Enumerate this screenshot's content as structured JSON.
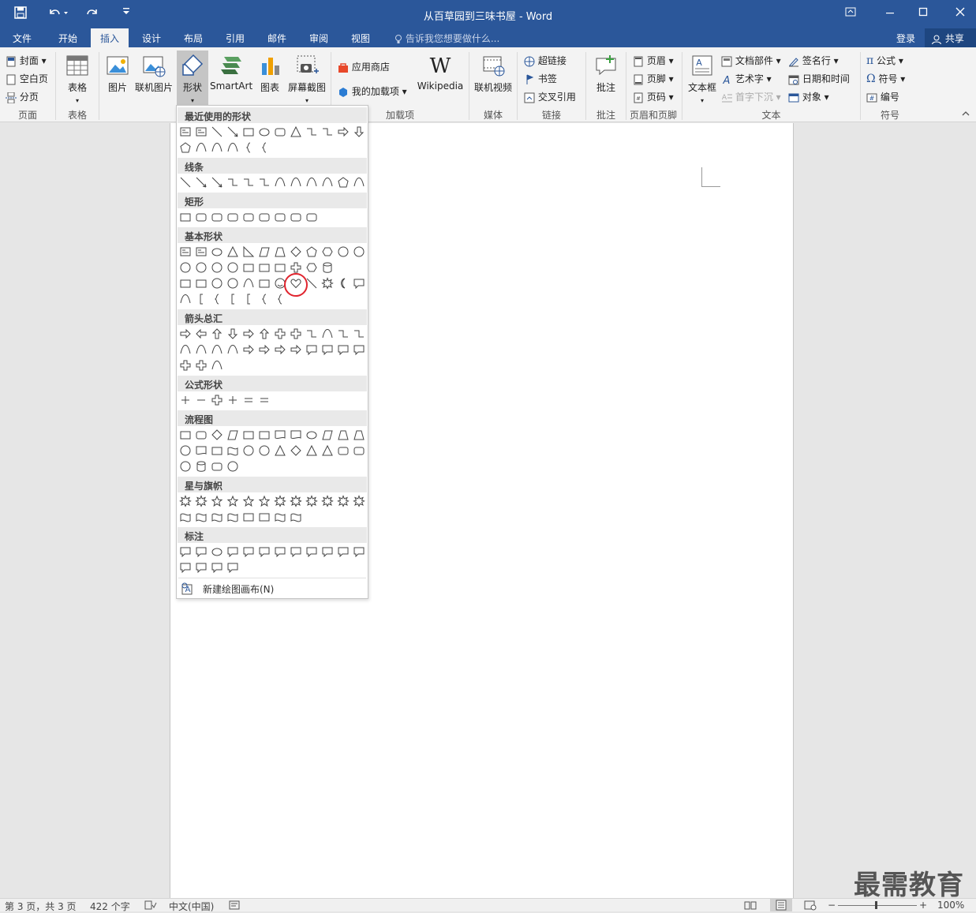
{
  "window": {
    "title": "从百草园到三味书屋 - Word"
  },
  "tabs": [
    {
      "label": "文件"
    },
    {
      "label": "开始"
    },
    {
      "label": "插入"
    },
    {
      "label": "设计"
    },
    {
      "label": "布局"
    },
    {
      "label": "引用"
    },
    {
      "label": "邮件"
    },
    {
      "label": "审阅"
    },
    {
      "label": "视图"
    }
  ],
  "active_tab": "插入",
  "tell_me": "告诉我您想要做什么...",
  "account": {
    "signin": "登录",
    "share": "共享"
  },
  "ribbon": {
    "pages": {
      "cover": "封面",
      "blank": "空白页",
      "break": "分页",
      "group": "页面"
    },
    "tables": {
      "table": "表格",
      "group": "表格"
    },
    "illustrations": {
      "picture": "图片",
      "online_picture": "联机图片",
      "shapes": "形状",
      "smartart": "SmartArt",
      "chart": "图表",
      "screenshot": "屏幕截图"
    },
    "addins": {
      "store": "应用商店",
      "my_addins": "我的加载项",
      "wikipedia": "Wikipedia",
      "group": "加载项"
    },
    "media": {
      "online_video": "联机视频",
      "group": "媒体"
    },
    "links": {
      "hyperlink": "超链接",
      "bookmark": "书签",
      "crossref": "交叉引用",
      "group": "链接"
    },
    "comments": {
      "comment": "批注",
      "group": "批注"
    },
    "header_footer": {
      "header": "页眉",
      "footer": "页脚",
      "page_number": "页码",
      "group": "页眉和页脚"
    },
    "text": {
      "textbox": "文本框",
      "quick_parts": "文档部件",
      "wordart": "艺术字",
      "dropcap": "首字下沉",
      "signature": "签名行",
      "datetime": "日期和时间",
      "object": "对象",
      "group": "文本"
    },
    "symbols": {
      "equation": "公式",
      "symbol": "符号",
      "number": "编号",
      "group": "符号"
    }
  },
  "shapes_menu": {
    "sections": [
      "最近使用的形状",
      "线条",
      "矩形",
      "基本形状",
      "箭头总汇",
      "公式形状",
      "流程图",
      "星与旗帜",
      "标注"
    ],
    "highlighted_shape": "heart",
    "new_canvas": "新建绘图画布(N)"
  },
  "status": {
    "page": "第 3 页，共 3 页",
    "words": "422 个字",
    "language": "中文(中国)",
    "zoom": "100%"
  },
  "watermark": "最需教育",
  "colors": {
    "accent": "#2b579a",
    "highlight_ring": "#e0242e"
  }
}
